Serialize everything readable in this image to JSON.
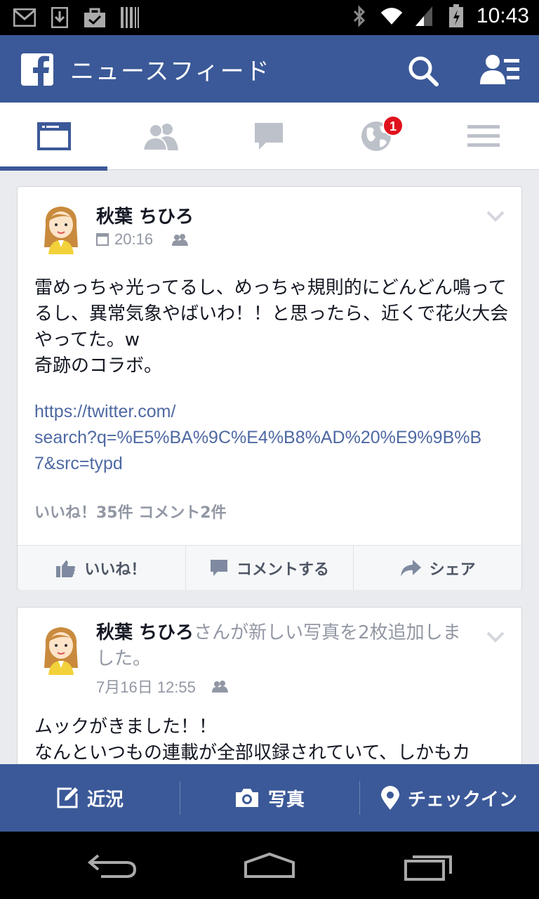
{
  "status_bar": {
    "time": "10:43",
    "left_icons": [
      "gmail-icon",
      "download-icon",
      "bag-check-icon",
      "barcode-icon"
    ],
    "right_icons": [
      "bluetooth-icon",
      "wifi-icon",
      "signal-icon",
      "battery-icon"
    ]
  },
  "app_bar": {
    "title": "ニュースフィード"
  },
  "tabs": [
    {
      "name": "news-feed",
      "icon": "news-feed-icon",
      "active": true
    },
    {
      "name": "friends",
      "icon": "friends-icon",
      "active": false
    },
    {
      "name": "messages",
      "icon": "messages-icon",
      "active": false
    },
    {
      "name": "notifications",
      "icon": "globe-icon",
      "active": false,
      "badge": "1"
    },
    {
      "name": "more",
      "icon": "menu-icon",
      "active": false
    }
  ],
  "posts": [
    {
      "author": "秋葉 ちひろ",
      "time": "20:16",
      "text": "雷めっちゃ光ってるし、めっちゃ規則的にどんどん鳴ってるし、異常気象やばいわ！！と思ったら、近くで花火大会やってた。w\n奇跡のコラボ。",
      "link_line1": "https://twitter.com/",
      "link_line2": "search?q=%E5%BA%9C%E4%B8%AD%20%E9%9B%B",
      "link_line3": "7&src=typd",
      "counts": "いいね！35件 コメント2件",
      "actions": {
        "like": "いいね！",
        "comment": "コメントする",
        "share": "シェア"
      }
    },
    {
      "author": "秋葉 ちひろ",
      "action_text": "さんが新しい写真を2枚追加しました。",
      "time": "7月16日 12:55",
      "text": "ムックがきました！！\nなんといつもの連載が全部収録されていて、しかもカ"
    }
  ],
  "composer": {
    "status": "近況",
    "photo": "写真",
    "checkin": "チェックイン"
  },
  "colors": {
    "brand": "#3b5998",
    "link": "#4e69a2",
    "badge": "#e0121d"
  }
}
